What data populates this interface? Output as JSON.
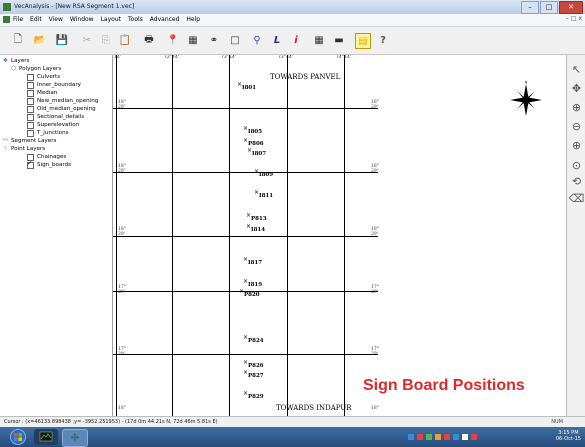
{
  "window": {
    "title": "VecAnalysis - [New RSA Segment 1.vec]",
    "min": "–",
    "max": "□",
    "close": "✕"
  },
  "menu": {
    "items": [
      "File",
      "Edit",
      "View",
      "Window",
      "Layout",
      "Tools",
      "Advanced",
      "Help"
    ],
    "mdi_controls": [
      "–",
      "□",
      "x"
    ]
  },
  "toolbar": {
    "buttons": [
      {
        "name": "new-icon",
        "glyph": "🗋"
      },
      {
        "name": "open-icon",
        "glyph": "📂"
      },
      {
        "name": "save-icon",
        "glyph": "💾"
      },
      {
        "name": "cut-icon",
        "glyph": "✂"
      },
      {
        "name": "copy-icon",
        "glyph": "⎘"
      },
      {
        "name": "paste-icon",
        "glyph": "📋"
      },
      {
        "name": "print-icon",
        "glyph": "🖶"
      },
      {
        "name": "pin-icon",
        "glyph": "📍"
      },
      {
        "name": "table-icon",
        "glyph": "▦"
      },
      {
        "name": "binoculars-icon",
        "glyph": "⚭"
      },
      {
        "name": "rectangle-icon",
        "glyph": "□"
      },
      {
        "name": "filter-icon",
        "glyph": "⚲"
      },
      {
        "name": "length-icon",
        "glyph": "L"
      },
      {
        "name": "info-icon",
        "glyph": "i"
      },
      {
        "name": "grid-icon",
        "glyph": "▦"
      },
      {
        "name": "dash-icon",
        "glyph": "▬"
      },
      {
        "name": "folder-icon",
        "glyph": "▤"
      },
      {
        "name": "help-icon",
        "glyph": "?"
      }
    ]
  },
  "layers": {
    "root": "Layers",
    "polygon_group": "Polygon Layers",
    "polygon_items": [
      "Culverts",
      "Inner_boundary",
      "Median",
      "New_median_opening",
      "Old_median_opening",
      "Sectional_details",
      "Superelevation",
      "T_junctions"
    ],
    "segment_group": "Segment Layers",
    "point_group": "Point Layers",
    "point_items": [
      {
        "label": "Chainages",
        "checked": false
      },
      {
        "label": "Sign_boards",
        "checked": true
      }
    ]
  },
  "map": {
    "top_ruler": [
      "14'",
      "72°44'",
      "73°14'",
      "73°44'",
      "74°14'"
    ],
    "left_ticks": [
      "18°",
      "29'",
      "18°",
      "29'",
      "18°",
      "29'",
      "17°",
      "29'",
      "17°",
      "29'",
      "18°"
    ],
    "right_ticks": [
      "18°",
      "29'",
      "18°",
      "29'",
      "18°",
      "29'",
      "17°",
      "29'",
      "17°",
      "29'",
      "18°"
    ],
    "top_label": "TOWARDS PANVEL",
    "bottom_label": "TOWARDS INDAPUR",
    "sign_boards": [
      "I801",
      "I805",
      "P806",
      "I807",
      "I809",
      "I811",
      "P813",
      "I814",
      "I817",
      "I819",
      "P820",
      "P824",
      "P826",
      "P827",
      "P829"
    ],
    "compass_letter": "N"
  },
  "overlay_title": "Sign Board Positions",
  "status": {
    "cursor": "Cursor : (x=46133.898438 ,y= -3952.251953) - (17d 0m 44.21s N, 72d 46m 5.81s E)",
    "mode": "NUM"
  },
  "clock": {
    "time": "3:15 PM",
    "date": "06-Oct-15"
  },
  "colors": {
    "overlay": "#e0282a",
    "taskbar": "#2e5a8e",
    "close": "#c9483c"
  }
}
